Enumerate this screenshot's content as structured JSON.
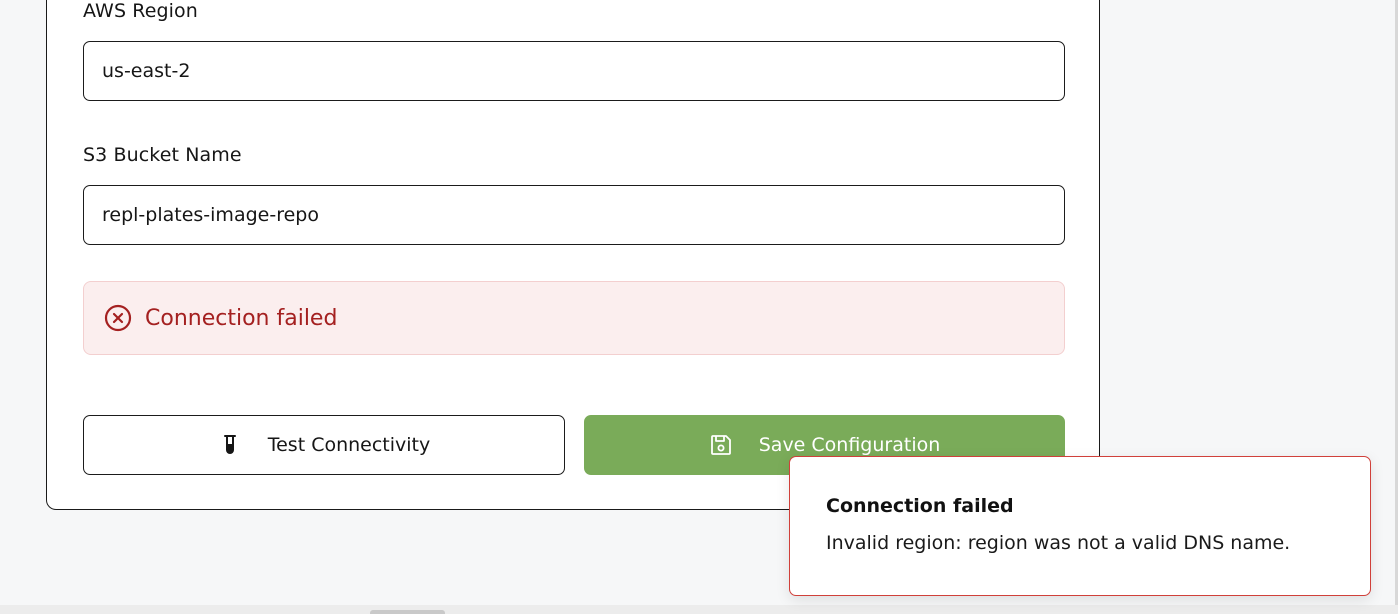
{
  "form": {
    "region": {
      "label": "AWS Region",
      "value": "us-east-2"
    },
    "bucket": {
      "label": "S3 Bucket Name",
      "value": "repl-plates-image-repo"
    }
  },
  "alert": {
    "icon": "x-circle-icon",
    "message": "Connection failed",
    "color": "#a42020",
    "background": "#fbeeee"
  },
  "buttons": {
    "test": {
      "icon": "test-tube-icon",
      "label": "Test Connectivity"
    },
    "save": {
      "icon": "save-disk-icon",
      "label": "Save Configuration",
      "color": "#7aab59"
    }
  },
  "toast": {
    "title": "Connection failed",
    "message": "Invalid region: region was not a valid DNS name.",
    "border_color": "#d0403a"
  }
}
